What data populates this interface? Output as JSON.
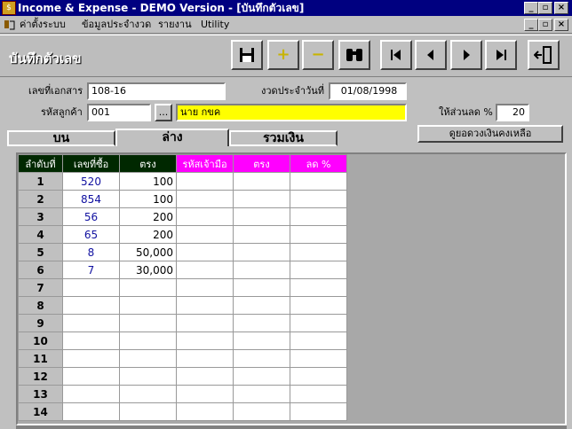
{
  "window": {
    "title": "Income & Expense - DEMO Version - [บันทึกตัวเลข]",
    "min": "_",
    "max": "▫",
    "close": "×"
  },
  "menu": {
    "items": [
      "ค่าตั้งระบบ",
      "ข้อมูลประจำงวด",
      "รายงาน",
      "Utility"
    ]
  },
  "form": {
    "title": "บันทึกตัวเลข"
  },
  "toolbar": {
    "save_icon": "save-icon",
    "add": "+",
    "remove": "−",
    "find": "⚲",
    "first": "|◀",
    "prev": "◀",
    "next": "▶",
    "last": "▶|",
    "exit": "exit-door-icon"
  },
  "fields": {
    "doc_label": "เลขที่เอกสาร",
    "doc_value": "108-16",
    "period_label": "งวดประจำวันที่",
    "period_value": "01/08/1998",
    "cust_label": "รหัสลูกค้า",
    "cust_value": "001",
    "cust_lookup": "...",
    "cust_name": "นาย กขค",
    "discount_label": "ให้ส่วนลด %",
    "discount_value": "20"
  },
  "tabs": [
    "บน",
    "ล่าง",
    "รวมเงิน"
  ],
  "balance_button": "ดูยอดวงเงินคงเหลือ",
  "grid": {
    "headers": [
      "ลำดับที่",
      "เลขที่ซื้อ",
      "ตรง",
      "รหัสเจ้ามือ",
      "ตรง",
      "ลด %"
    ],
    "rows": [
      {
        "n": "1",
        "num": "520",
        "amt": "100"
      },
      {
        "n": "2",
        "num": "854",
        "amt": "100"
      },
      {
        "n": "3",
        "num": "56",
        "amt": "200"
      },
      {
        "n": "4",
        "num": "65",
        "amt": "200"
      },
      {
        "n": "5",
        "num": "8",
        "amt": "50,000"
      },
      {
        "n": "6",
        "num": "7",
        "amt": "30,000"
      },
      {
        "n": "7",
        "num": "",
        "amt": ""
      },
      {
        "n": "8",
        "num": "",
        "amt": ""
      },
      {
        "n": "9",
        "num": "",
        "amt": ""
      },
      {
        "n": "10",
        "num": "",
        "amt": ""
      },
      {
        "n": "11",
        "num": "",
        "amt": ""
      },
      {
        "n": "12",
        "num": "",
        "amt": ""
      },
      {
        "n": "13",
        "num": "",
        "amt": ""
      },
      {
        "n": "14",
        "num": "",
        "amt": ""
      }
    ]
  }
}
